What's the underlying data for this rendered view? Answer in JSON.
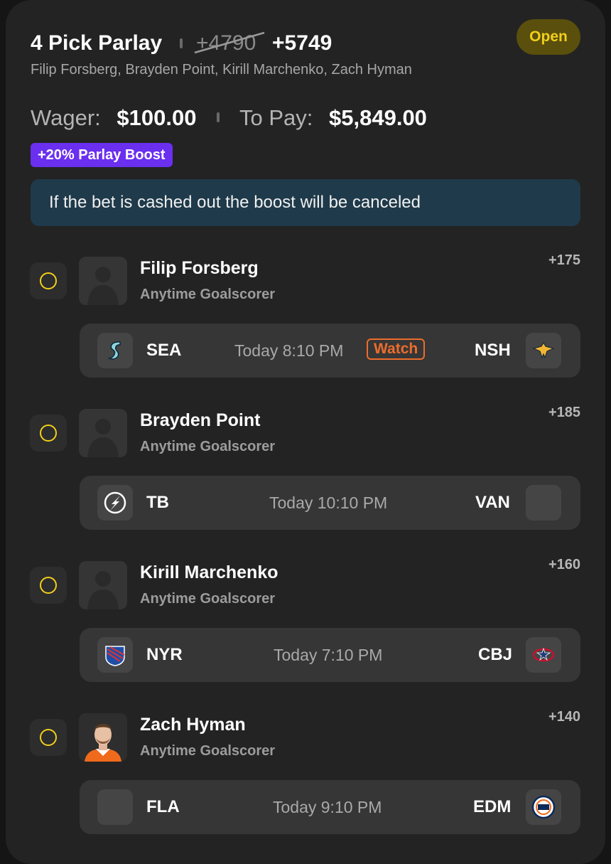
{
  "header": {
    "title": "4 Pick Parlay",
    "original_odds": "+4790",
    "boosted_odds": "+5749",
    "status_badge": "Open",
    "players_summary": "Filip Forsberg, Brayden Point, Kirill Marchenko, Zach Hyman"
  },
  "wager": {
    "wager_label": "Wager:",
    "wager_amount": "$100.00",
    "payout_label": "To Pay:",
    "payout_amount": "$5,849.00"
  },
  "boost_label": "+20% Parlay Boost",
  "notice": "If the bet is cashed out the boost will be canceled",
  "colors": {
    "accent_yellow": "#f2cf1a",
    "boost_purple": "#6b2ff0",
    "watch_orange": "#ea6d2c",
    "notice_bg": "#1f3a4a"
  },
  "legs": [
    {
      "player": "Filip Forsberg",
      "market": "Anytime Goalscorer",
      "odds": "+175",
      "avatar_icon": "player-silhouette-icon",
      "away_team": "SEA",
      "away_logo": "kraken-logo-icon",
      "home_team": "NSH",
      "home_logo": "predators-logo-icon",
      "time": "Today 8:10 PM",
      "watch_label": "Watch"
    },
    {
      "player": "Brayden Point",
      "market": "Anytime Goalscorer",
      "odds": "+185",
      "avatar_icon": "player-silhouette-icon",
      "away_team": "TB",
      "away_logo": "lightning-logo-icon",
      "home_team": "VAN",
      "home_logo": "team-logo-placeholder-icon",
      "time": "Today 10:10 PM"
    },
    {
      "player": "Kirill Marchenko",
      "market": "Anytime Goalscorer",
      "odds": "+160",
      "avatar_icon": "player-silhouette-icon",
      "away_team": "NYR",
      "away_logo": "rangers-logo-icon",
      "home_team": "CBJ",
      "home_logo": "blue-jackets-logo-icon",
      "time": "Today 7:10 PM"
    },
    {
      "player": "Zach Hyman",
      "market": "Anytime Goalscorer",
      "odds": "+140",
      "avatar_icon": "player-photo-icon",
      "away_team": "FLA",
      "away_logo": "team-logo-placeholder-icon",
      "home_team": "EDM",
      "home_logo": "oilers-logo-icon",
      "time": "Today 9:10 PM"
    }
  ]
}
